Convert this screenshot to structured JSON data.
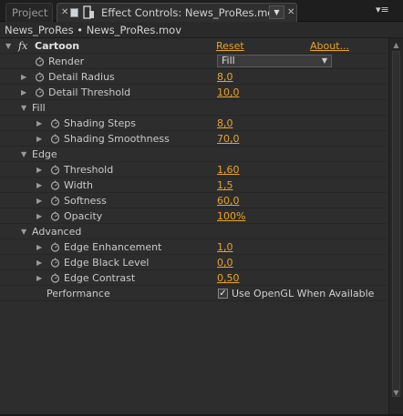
{
  "tabs": {
    "project_label": "Project",
    "effect_controls_label": "Effect Controls: News_ProRes.mov",
    "close_glyph": "✕",
    "dropdown_glyph": "▼",
    "menu_glyph": "▾≡"
  },
  "header": {
    "breadcrumb": "News_ProRes • News_ProRes.mov"
  },
  "effect": {
    "fx_label": "fx",
    "name": "Cartoon",
    "reset_label": "Reset",
    "about_label": "About...",
    "render": {
      "label": "Render",
      "value": "Fill"
    },
    "detail_radius": {
      "label": "Detail Radius",
      "value": "8,0"
    },
    "detail_threshold": {
      "label": "Detail Threshold",
      "value": "10,0"
    },
    "fill": {
      "label": "Fill",
      "shading_steps": {
        "label": "Shading Steps",
        "value": "8,0"
      },
      "shading_smoothness": {
        "label": "Shading Smoothness",
        "value": "70,0"
      }
    },
    "edge": {
      "label": "Edge",
      "threshold": {
        "label": "Threshold",
        "value": "1,60"
      },
      "width": {
        "label": "Width",
        "value": "1,5"
      },
      "softness": {
        "label": "Softness",
        "value": "60,0"
      },
      "opacity": {
        "label": "Opacity",
        "value": "100%"
      }
    },
    "advanced": {
      "label": "Advanced",
      "edge_enhancement": {
        "label": "Edge Enhancement",
        "value": "1,0"
      },
      "edge_black_level": {
        "label": "Edge Black Level",
        "value": "0,0"
      },
      "edge_contrast": {
        "label": "Edge Contrast",
        "value": "0,50"
      }
    },
    "performance": {
      "label": "Performance",
      "checkbox_label": "Use OpenGL When Available",
      "checked": true
    }
  },
  "colors": {
    "value": "#e8a32a",
    "background": "#2d2d2d",
    "text": "#c9c9c9"
  }
}
